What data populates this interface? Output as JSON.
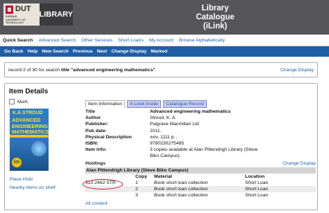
{
  "header": {
    "logo_dut": "DUT",
    "logo_sub_1": "DURBAN",
    "logo_sub_2": "UNIVERSITY OF",
    "logo_sub_3": "TECHNOLOGY",
    "logo_library": "LIBRARY",
    "title_line1": "Library",
    "title_line2": "Catalogue",
    "title_line3": "(iLink)"
  },
  "topnav": [
    "Quick Search",
    "Advanced Search",
    "Other Services",
    "Short Loans",
    "My Account",
    "Browse Alphabetically"
  ],
  "actions": [
    "Go Back",
    "Help",
    "New Search",
    "Previous",
    "Next",
    "Change Display",
    "Marked"
  ],
  "record": {
    "prefix": "record 2 of 30 for search",
    "field": "title",
    "query": "\"advanced engineering mathematics\"",
    "change_display": "Change Display"
  },
  "item": {
    "heading": "Item Details",
    "mark_label": "Mark",
    "cover": {
      "author": "K.A.STROUD",
      "title_lines": [
        "ADVANCED",
        "ENGINEERING",
        "MATHEMATICS"
      ],
      "edition": "5th"
    },
    "place_hold": "Place Hold",
    "nearby": "Nearby items on shelf",
    "tabs": [
      "Item Information",
      "A Look Inside",
      "Catalogue Record"
    ],
    "fields": [
      {
        "label": "Title",
        "value": "Advanced engineering mathematics"
      },
      {
        "label": "Author",
        "value": "Stroud, K. A."
      },
      {
        "label": "Publisher:",
        "value": "Palgrave Macmillan Ltd"
      },
      {
        "label": "Pub date:",
        "value": "2011."
      },
      {
        "label": "Physical Description",
        "value": "xxiv, 1111 p. ;"
      },
      {
        "label": "ISBN:",
        "value": "9780230275485"
      },
      {
        "label": "Item info:",
        "value": "3 copies available at Alan Pittendrigh Library (Steve"
      }
    ],
    "item_info_line2": "Biko Campus).",
    "holdings_label": "Holdings",
    "holdings_change_display": "Change Display",
    "library_name": "Alan Pittendrigh Library (Steve Biko Campus)",
    "holdings_columns": [
      "",
      "Copy",
      "Material",
      "Location"
    ],
    "holdings_rows": [
      {
        "call": "510.2462 STR",
        "copy": "1",
        "material": "Book short loan collection",
        "location": "Short Loan"
      },
      {
        "call": "",
        "copy": "2",
        "material": "Book short loan collection",
        "location": "Short Loan"
      },
      {
        "call": "",
        "copy": "3",
        "material": "Book short loan collection",
        "location": "Short Loan"
      }
    ],
    "all_content": "All content"
  }
}
